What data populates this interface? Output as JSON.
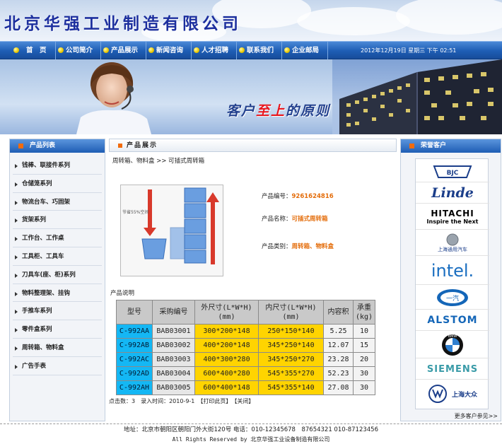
{
  "header": {
    "title": "北京华强工业制造有限公司"
  },
  "nav": {
    "items": [
      "首　页",
      "公司简介",
      "产品展示",
      "新闻咨询",
      "人才招聘",
      "联系我们",
      "企业邮局"
    ],
    "datetime": "2012年12月19日 星期三 下午 02:51"
  },
  "banner": {
    "slogan_a": "客户",
    "slogan_hl": "至上",
    "slogan_b": "的原则"
  },
  "sidebar_left": {
    "title": "产品列表",
    "items": [
      "钱棒、联接件系列",
      "仓储笼系列",
      "物流台车、巧固架",
      "货架系列",
      "工作台、工作桌",
      "工具柜、工具车",
      "刀具车(座、柜)系列",
      "物料整理架、挂钩",
      "手推车系列",
      "零件盒系列",
      "周转箱、物料盒",
      "广告手表"
    ]
  },
  "main": {
    "header": "产品展示",
    "breadcrumb": "周转箱、物料盒 >> 可插式周转箱",
    "image_caption": "节省55%空间",
    "product_no_label": "产品编号：",
    "product_no": "9261624816",
    "product_name_label": "产品名称：",
    "product_name": "可插式周转箱",
    "product_cat_label": "产品类别：",
    "product_cat": "周转箱、物料盒",
    "desc_label": "产品说明",
    "table": {
      "headers": [
        "型号",
        "采购编号",
        "外尺寸(L*W*H)(mm)",
        "内尺寸(L*W*H)(mm)",
        "内容积",
        "承重(kg)"
      ],
      "rows": [
        [
          "C-992AA",
          "BAB03001",
          "300*200*148",
          "250*150*140",
          "5.25",
          "10"
        ],
        [
          "C-992AB",
          "BAB03002",
          "400*200*148",
          "345*250*140",
          "12.07",
          "15"
        ],
        [
          "C-992AC",
          "BAB03003",
          "400*300*280",
          "345*250*270",
          "23.28",
          "20"
        ],
        [
          "C-992AD",
          "BAB03004",
          "600*400*280",
          "545*355*270",
          "52.23",
          "30"
        ],
        [
          "C-992AH",
          "BAB03005",
          "600*400*148",
          "545*355*140",
          "27.08",
          "30"
        ]
      ]
    },
    "meta": "点击数：3　录入时间：2010-9-1　【打印此页】　【关闭】"
  },
  "sidebar_right": {
    "title": "荣誉客户",
    "logos": [
      "BJC",
      "Linde",
      "HITACHI",
      "Inspire the Next",
      "上海通用汽车",
      "intel.",
      "一汽",
      "ALSTOM",
      "BMW",
      "SIEMENS",
      "上海大众"
    ],
    "more": "更多客户参见>>"
  },
  "footer": {
    "address": "地址：北京市朝阳区朝阳门外大街120号 电话：010-12345678　87654321 010-87123456",
    "copyright": "All Rights Reserved by 北京华强工业设备制造有限公司"
  },
  "colors": {
    "nav_blue": "#1e5db4",
    "accent_orange": "#e46d0b",
    "title_blue": "#1c2f9e",
    "model_cell": "#14b7f4",
    "size_cell": "#ffd400"
  }
}
